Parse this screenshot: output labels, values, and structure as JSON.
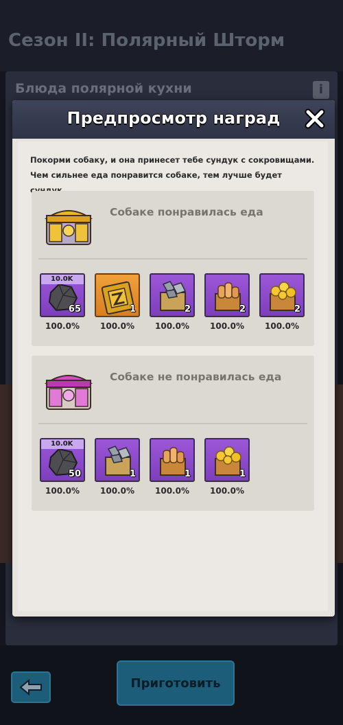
{
  "background": {
    "season_title": "Сезон II: Полярный Шторм",
    "subtitle": "Блюда полярной кухни",
    "info_icon": "i",
    "cook_button": "Приготовить"
  },
  "modal": {
    "title": "Предпросмотр наград",
    "description_line1": "Покорми собаку, и она принесет тебе сундук с сокровищами.",
    "description_line2": "Чем сильнее еда понравится собаке, тем лучше будет сундук.",
    "sections": [
      {
        "title": "Собаке понравилась еда",
        "chest_icon": "gold-chest-icon",
        "rewards": [
          {
            "icon": "ore-icon",
            "badge": "10.0K",
            "count": "65",
            "chance": "100.0%",
            "tile": "purple"
          },
          {
            "icon": "gold-chest-card-icon",
            "count": "1",
            "chance": "100.0%",
            "tile": "orange"
          },
          {
            "icon": "stone-crate-icon",
            "count": "2",
            "chance": "100.0%",
            "tile": "purple"
          },
          {
            "icon": "wood-crate-icon",
            "count": "2",
            "chance": "100.0%",
            "tile": "purple"
          },
          {
            "icon": "gold-crate-icon",
            "count": "2",
            "chance": "100.0%",
            "tile": "purple"
          }
        ]
      },
      {
        "title": "Собаке не понравилась еда",
        "chest_icon": "pink-chest-icon",
        "rewards": [
          {
            "icon": "ore-icon",
            "badge": "10.0K",
            "count": "50",
            "chance": "100.0%",
            "tile": "purple"
          },
          {
            "icon": "stone-crate-icon",
            "count": "1",
            "chance": "100.0%",
            "tile": "purple"
          },
          {
            "icon": "wood-crate-icon",
            "count": "1",
            "chance": "100.0%",
            "tile": "purple"
          },
          {
            "icon": "gold-crate-icon",
            "count": "1",
            "chance": "100.0%",
            "tile": "purple"
          }
        ]
      }
    ]
  },
  "colors": {
    "tile_purple": "#8b4bcf",
    "tile_orange": "#e88f2c",
    "button": "#1c5e79"
  }
}
